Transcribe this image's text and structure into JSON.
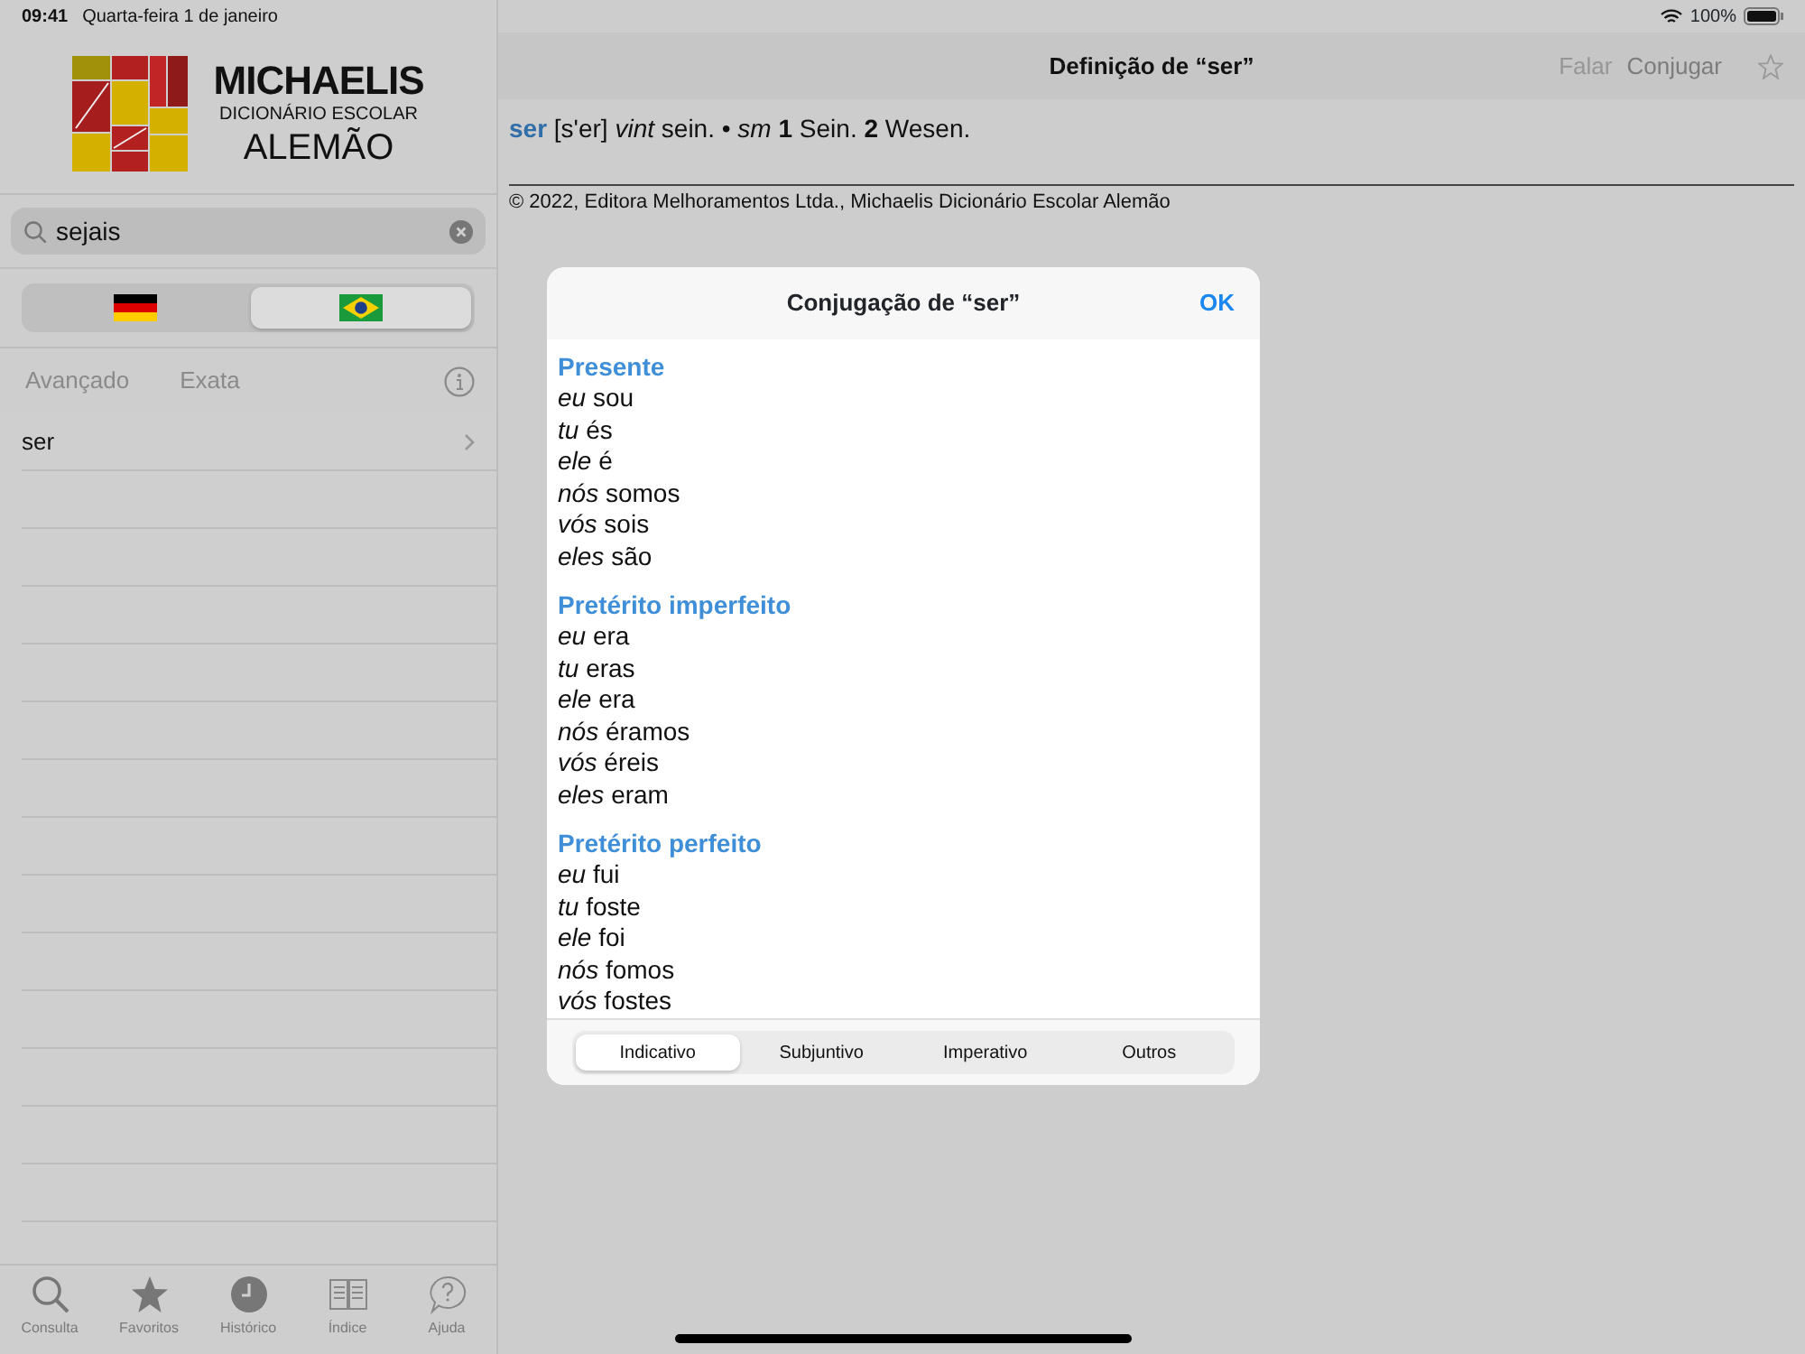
{
  "status_bar": {
    "time": "09:41",
    "date": "Quarta-feira 1 de janeiro",
    "battery": "100%"
  },
  "sidebar": {
    "logo": {
      "title": "MICHAELIS",
      "subtitle": "DICIONÁRIO ESCOLAR",
      "language": "ALEMÃO"
    },
    "search": {
      "value": "sejais"
    },
    "languages": [
      {
        "selected": false
      },
      {
        "selected": true
      }
    ],
    "filters": [
      {
        "label": "Avançado"
      },
      {
        "label": "Exata"
      }
    ],
    "results": [
      {
        "label": "ser"
      }
    ]
  },
  "tab_bar": [
    {
      "label": "Consulta"
    },
    {
      "label": "Favoritos"
    },
    {
      "label": "Histórico"
    },
    {
      "label": "Índice"
    },
    {
      "label": "Ajuda"
    }
  ],
  "detail": {
    "title": "Definição de “ser”",
    "actions": [
      {
        "label": "Falar",
        "disabled": true
      },
      {
        "label": "Conjugar",
        "disabled": false
      }
    ],
    "headword": "ser",
    "definition": "[s'er] *vint* sein. • *sm* **1** Sein. **2** Wesen.",
    "copyright": "© 2022, Editora Melhoramentos Ltda., Michaelis Dicionário Escolar Alemão"
  },
  "dialog": {
    "title": "Conjugação de “ser”",
    "ok": "OK",
    "sections": [
      {
        "heading": "Presente",
        "lines": [
          {
            "person": "eu",
            "form": "sou"
          },
          {
            "person": "tu",
            "form": "és"
          },
          {
            "person": "ele",
            "form": "é"
          },
          {
            "person": "nós",
            "form": "somos"
          },
          {
            "person": "vós",
            "form": "sois"
          },
          {
            "person": "eles",
            "form": "são"
          }
        ]
      },
      {
        "heading": "Pretérito imperfeito",
        "lines": [
          {
            "person": "eu",
            "form": "era"
          },
          {
            "person": "tu",
            "form": "eras"
          },
          {
            "person": "ele",
            "form": "era"
          },
          {
            "person": "nós",
            "form": "éramos"
          },
          {
            "person": "vós",
            "form": "éreis"
          },
          {
            "person": "eles",
            "form": "eram"
          }
        ]
      },
      {
        "heading": "Pretérito perfeito",
        "lines": [
          {
            "person": "eu",
            "form": "fui"
          },
          {
            "person": "tu",
            "form": "foste"
          },
          {
            "person": "ele",
            "form": "foi"
          },
          {
            "person": "nós",
            "form": "fomos"
          },
          {
            "person": "vós",
            "form": "fostes"
          }
        ]
      }
    ],
    "moods": [
      {
        "label": "Indicativo",
        "selected": true
      },
      {
        "label": "Subjuntivo",
        "selected": false
      },
      {
        "label": "Imperativo",
        "selected": false
      },
      {
        "label": "Outros",
        "selected": false
      }
    ]
  }
}
